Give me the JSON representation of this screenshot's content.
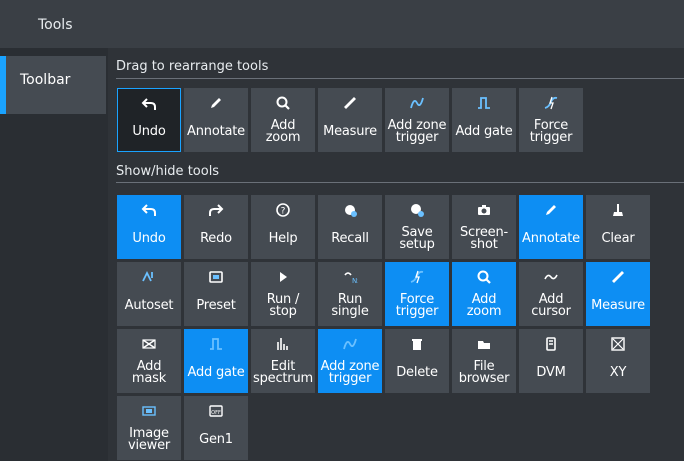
{
  "app": {
    "title": "Tools"
  },
  "sidebar": {
    "tab_label": "Toolbar"
  },
  "toolbar_section": {
    "title": "Drag to rearrange tools",
    "tiles": [
      {
        "label": "Undo",
        "icon": "undo-icon"
      },
      {
        "label": "Annotate",
        "icon": "pencil-icon"
      },
      {
        "label": "Add\nzoom",
        "icon": "zoom-icon"
      },
      {
        "label": "Measure",
        "icon": "ruler-icon"
      },
      {
        "label": "Add zone\ntrigger",
        "icon": "zone-trigger-icon"
      },
      {
        "label": "Add gate",
        "icon": "gate-icon"
      },
      {
        "label": "Force\ntrigger",
        "icon": "force-trigger-icon"
      }
    ]
  },
  "show_hide_section": {
    "title": "Show/hide tools",
    "tiles": [
      {
        "label": "Undo",
        "icon": "undo-icon",
        "active": true
      },
      {
        "label": "Redo",
        "icon": "redo-icon",
        "active": false
      },
      {
        "label": "Help",
        "icon": "help-icon",
        "active": false
      },
      {
        "label": "Recall",
        "icon": "recall-icon",
        "active": false
      },
      {
        "label": "Save\nsetup",
        "icon": "save-setup-icon",
        "active": false
      },
      {
        "label": "Screen-\nshot",
        "icon": "camera-icon",
        "active": false
      },
      {
        "label": "Annotate",
        "icon": "pencil-icon",
        "active": true
      },
      {
        "label": "Clear",
        "icon": "clear-icon",
        "active": false
      },
      {
        "label": "Autoset",
        "icon": "autoset-icon",
        "active": false
      },
      {
        "label": "Preset",
        "icon": "preset-icon",
        "active": false
      },
      {
        "label": "Run /\nstop",
        "icon": "run-stop-icon",
        "active": false
      },
      {
        "label": "Run\nsingle",
        "icon": "run-single-icon",
        "active": false
      },
      {
        "label": "Force\ntrigger",
        "icon": "force-trigger-icon",
        "active": true
      },
      {
        "label": "Add\nzoom",
        "icon": "zoom-icon",
        "active": true
      },
      {
        "label": "Add\ncursor",
        "icon": "cursor-icon",
        "active": false
      },
      {
        "label": "Measure",
        "icon": "ruler-icon",
        "active": true
      },
      {
        "label": "Add\nmask",
        "icon": "mask-icon",
        "active": false
      },
      {
        "label": "Add gate",
        "icon": "gate-icon",
        "active": true
      },
      {
        "label": "Edit\nspectrum",
        "icon": "spectrum-icon",
        "active": false
      },
      {
        "label": "Add zone\ntrigger",
        "icon": "zone-trigger-icon",
        "active": true
      },
      {
        "label": "Delete",
        "icon": "trash-icon",
        "active": false
      },
      {
        "label": "File\nbrowser",
        "icon": "file-browser-icon",
        "active": false
      },
      {
        "label": "DVM",
        "icon": "dvm-icon",
        "active": false
      },
      {
        "label": "XY",
        "icon": "xy-icon",
        "active": false
      },
      {
        "label": "Image\nviewer",
        "icon": "image-viewer-icon",
        "active": false
      },
      {
        "label": "Gen1",
        "icon": "generator-icon",
        "active": false
      }
    ]
  },
  "colors": {
    "accent": "#0d8ef3",
    "tile": "#454b52",
    "background": "#2f3338"
  }
}
